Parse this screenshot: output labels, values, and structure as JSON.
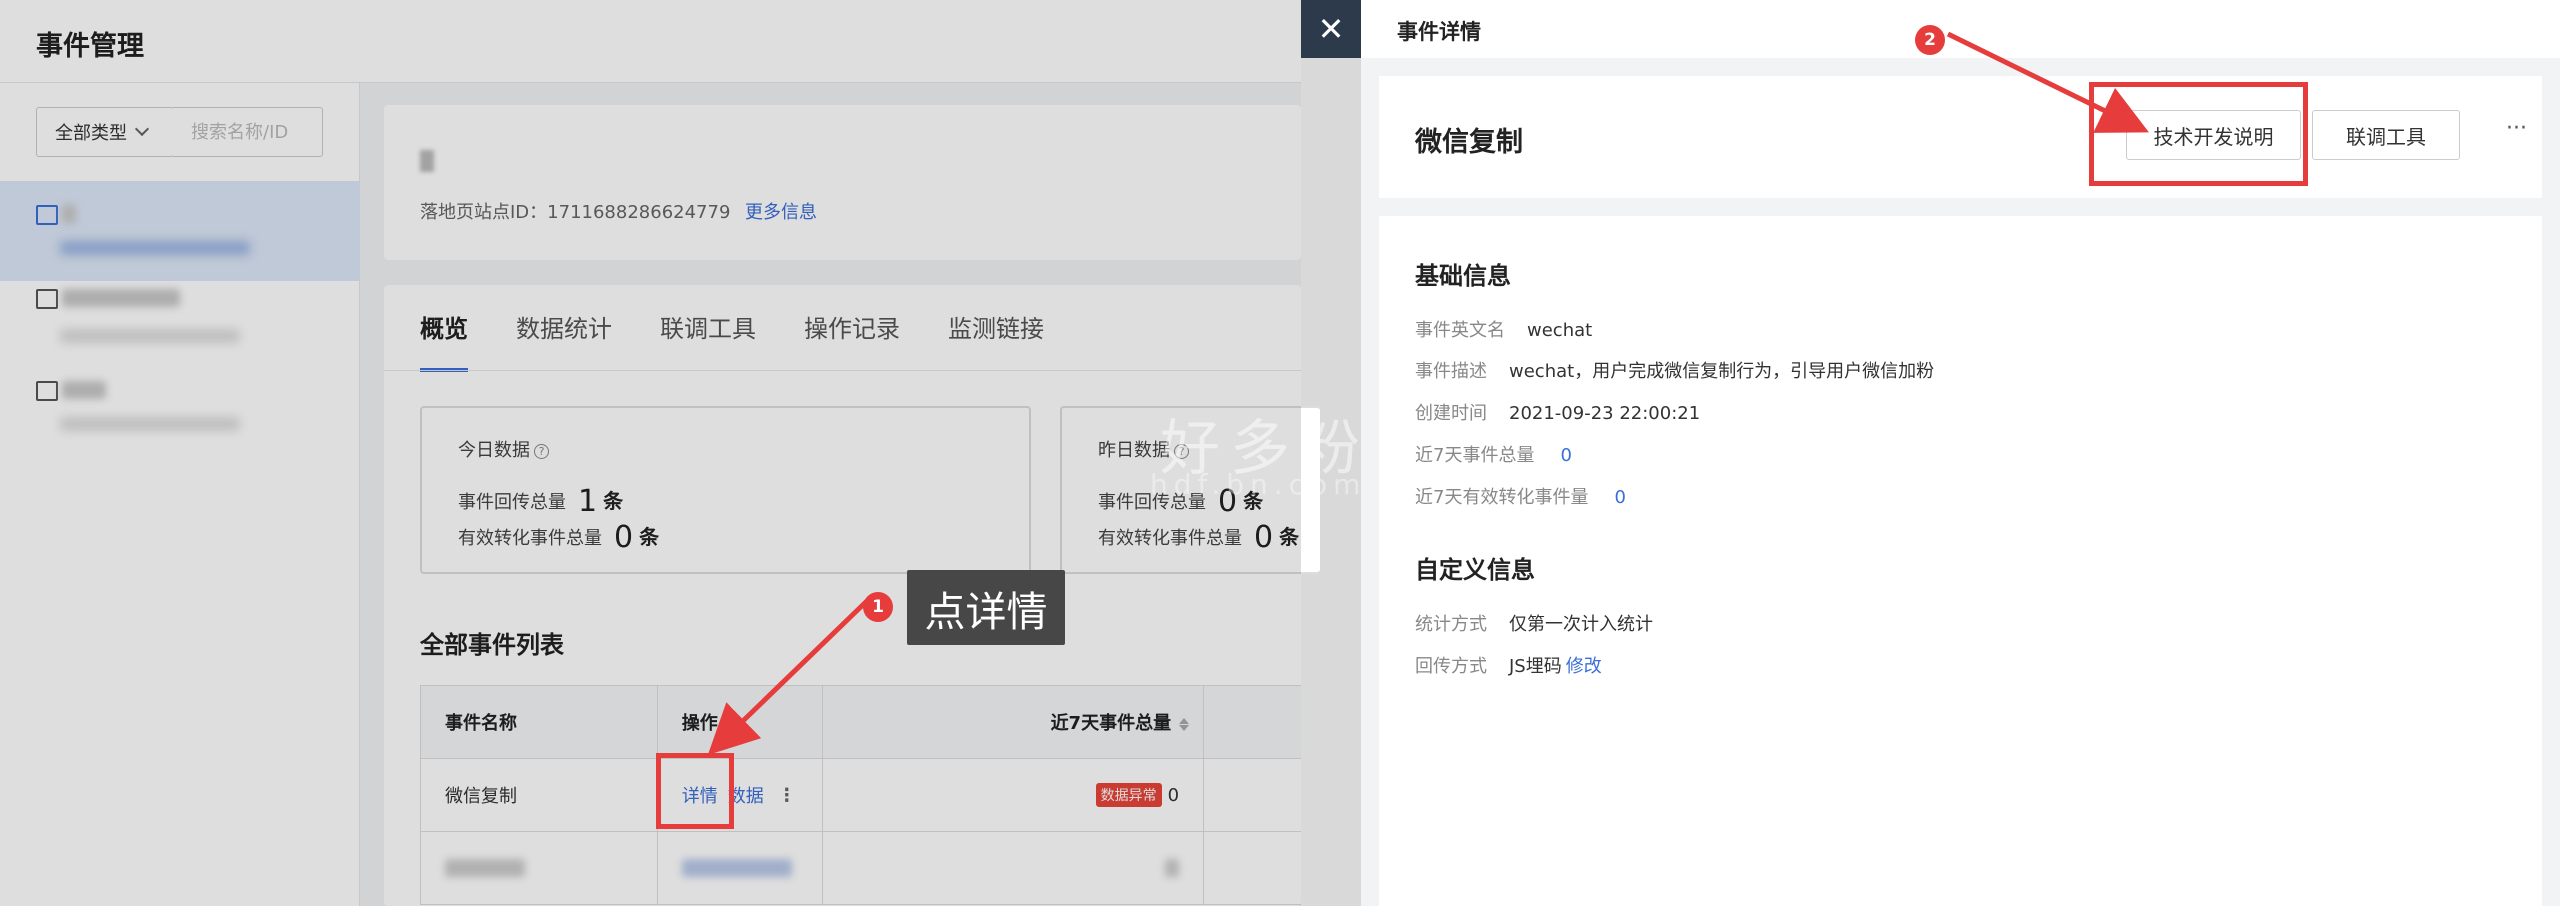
{
  "app": {
    "title": "事件管理"
  },
  "sidebar": {
    "type_select": "全部类型",
    "search_placeholder": "搜索名称/ID"
  },
  "site_info": {
    "site_id": "落地页站点ID：1711688286624779",
    "more_link": "更多信息"
  },
  "tabs": [
    "概览",
    "数据统计",
    "联调工具",
    "操作记录",
    "监测链接"
  ],
  "stats": {
    "today": {
      "title": "今日数据",
      "row1_label": "事件回传总量",
      "row1_value": "1",
      "row2_label": "有效转化事件总量",
      "row2_value": "0",
      "unit": "条"
    },
    "yesterday": {
      "title": "昨日数据",
      "row1_label": "事件回传总量",
      "row1_value": "0",
      "row2_label": "有效转化事件总量",
      "row2_value": "0",
      "unit": "条"
    }
  },
  "event_list": {
    "title": "全部事件列表",
    "headers": [
      "事件名称",
      "操作",
      "近7天事件总量"
    ],
    "rows": [
      {
        "name": "微信复制",
        "action_detail": "详情",
        "action_data": "数据",
        "kebab": "⋮",
        "badge": "数据异常",
        "total": "0"
      }
    ]
  },
  "drawer": {
    "title": "事件详情",
    "close_icon": "✕",
    "event_name": "微信复制",
    "buttons": {
      "tech_doc": "技术开发说明",
      "debug_tool": "联调工具",
      "more": "···"
    },
    "basic_section": {
      "title": "基础信息",
      "fields": [
        {
          "label": "事件英文名",
          "value": "wechat",
          "blue": false
        },
        {
          "label": "事件描述",
          "value": "wechat，用户完成微信复制行为，引导用户微信加粉",
          "blue": false
        },
        {
          "label": "创建时间",
          "value": "2021-09-23 22:00:21",
          "blue": false
        },
        {
          "label": "近7天事件总量",
          "value": "0",
          "blue": true
        },
        {
          "label": "近7天有效转化事件量",
          "value": "0",
          "blue": true
        }
      ]
    },
    "custom_section": {
      "title": "自定义信息",
      "stat_label": "统计方式",
      "stat_value": "仅第一次计入统计",
      "return_label": "回传方式",
      "return_value": "JS埋码",
      "modify_link": "修改"
    }
  },
  "annotations": {
    "step1": "1",
    "step2": "2",
    "tip": "点详情",
    "color": "#e63c3c"
  },
  "watermark": {
    "main": "好多粉",
    "sub": "hdf.bn.com"
  }
}
